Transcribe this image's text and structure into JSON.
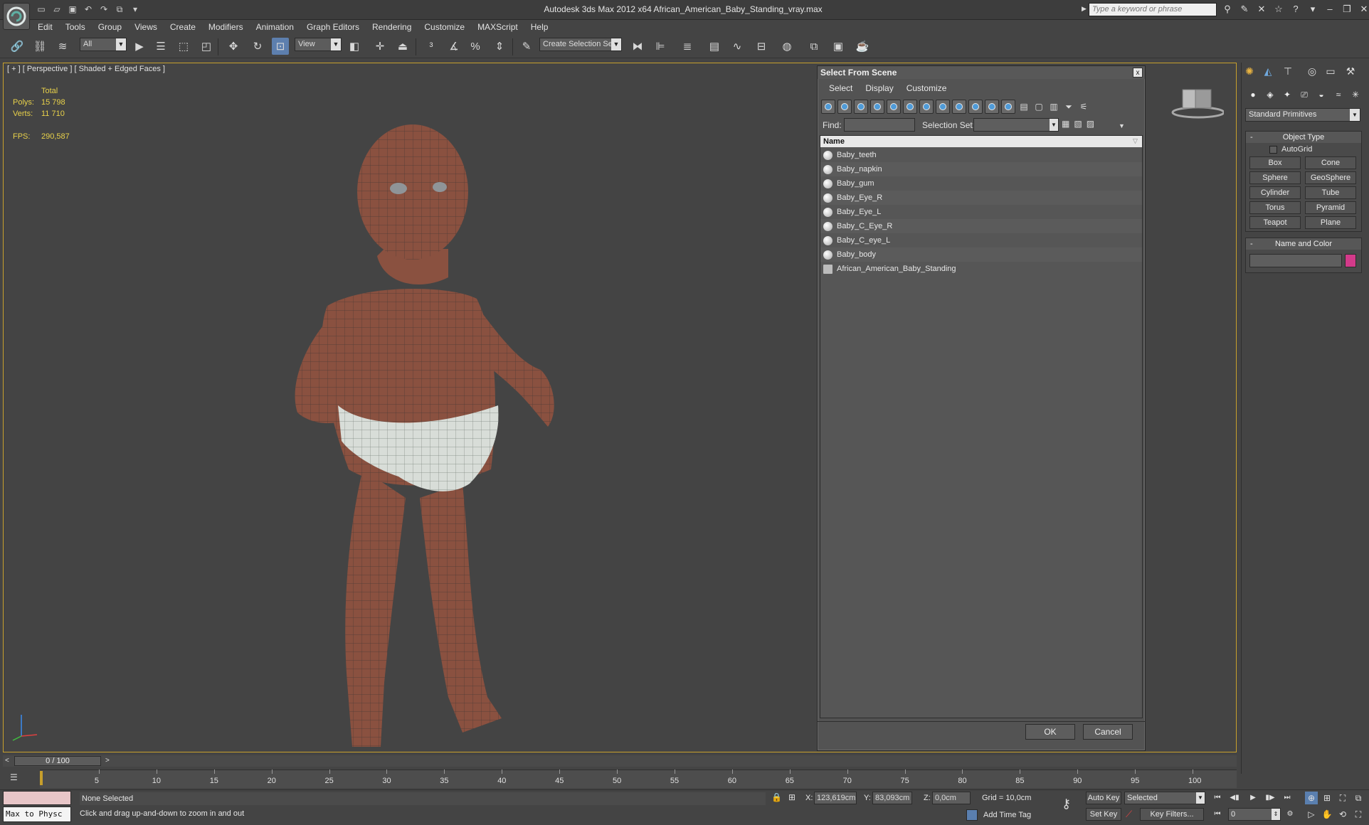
{
  "window": {
    "title": "Autodesk 3ds Max  2012 x64      African_American_Baby_Standing_vray.max",
    "search_placeholder": "Type a keyword or phrase"
  },
  "menu": [
    "Edit",
    "Tools",
    "Group",
    "Views",
    "Create",
    "Modifiers",
    "Animation",
    "Graph Editors",
    "Rendering",
    "Customize",
    "MAXScript",
    "Help"
  ],
  "toolbar": {
    "selection_filter": "All",
    "reference_coord": "View",
    "named_selection": "Create Selection Se"
  },
  "viewport": {
    "label": "[ + ] [ Perspective ] [ Shaded + Edged Faces ]",
    "stats": {
      "header": "Total",
      "polys_label": "Polys:",
      "polys": "15 798",
      "verts_label": "Verts:",
      "verts": "11 710",
      "fps_label": "FPS:",
      "fps": "290,587"
    },
    "colors": {
      "skin": "#8a5140",
      "diaper": "#d8ddd8",
      "frame": "#c8a12c"
    }
  },
  "dialog": {
    "title": "Select From Scene",
    "close": "x",
    "menu": [
      "Select",
      "Display",
      "Customize"
    ],
    "find_label": "Find:",
    "selection_set_label": "Selection Set:",
    "column_name": "Name",
    "items": [
      {
        "name": "Baby_teeth",
        "icon": "sphere-icon"
      },
      {
        "name": "Baby_napkin",
        "icon": "sphere-icon"
      },
      {
        "name": "Baby_gum",
        "icon": "sphere-icon"
      },
      {
        "name": "Baby_Eye_R",
        "icon": "sphere-icon"
      },
      {
        "name": "Baby_Eye_L",
        "icon": "sphere-icon"
      },
      {
        "name": "Baby_C_Eye_R",
        "icon": "sphere-icon"
      },
      {
        "name": "Baby_C_eye_L",
        "icon": "sphere-icon"
      },
      {
        "name": "Baby_body",
        "icon": "sphere-icon"
      },
      {
        "name": "African_American_Baby_Standing",
        "icon": "helper-icon"
      }
    ],
    "ok_label": "OK",
    "cancel_label": "Cancel"
  },
  "command_panel": {
    "category": "Standard Primitives",
    "object_type_title": "Object Type",
    "autogrid_label": "AutoGrid",
    "primitives": [
      "Box",
      "Cone",
      "Sphere",
      "GeoSphere",
      "Cylinder",
      "Tube",
      "Torus",
      "Pyramid",
      "Teapot",
      "Plane"
    ],
    "name_color_title": "Name and Color",
    "object_color": "#d33a8a"
  },
  "timeline": {
    "frame_display": "0 / 100",
    "ticks": [
      "5",
      "10",
      "15",
      "20",
      "25",
      "30",
      "35",
      "40",
      "45",
      "50",
      "55",
      "60",
      "65",
      "70",
      "75",
      "80",
      "85",
      "90",
      "95",
      "100"
    ]
  },
  "status": {
    "maxscript_listener": "Max to Physc",
    "selection": "None Selected",
    "prompt": "Click and drag up-and-down to zoom in and out",
    "x_label": "X:",
    "x_value": "123,619cm",
    "y_label": "Y:",
    "y_value": "83,093cm",
    "z_label": "Z:",
    "z_value": "0,0cm",
    "grid": "Grid = 10,0cm",
    "add_time_tag": "Add Time Tag",
    "auto_key": "Auto Key",
    "set_key": "Set Key",
    "key_mode": "Selected",
    "key_filters": "Key Filters...",
    "current_frame": "0"
  }
}
